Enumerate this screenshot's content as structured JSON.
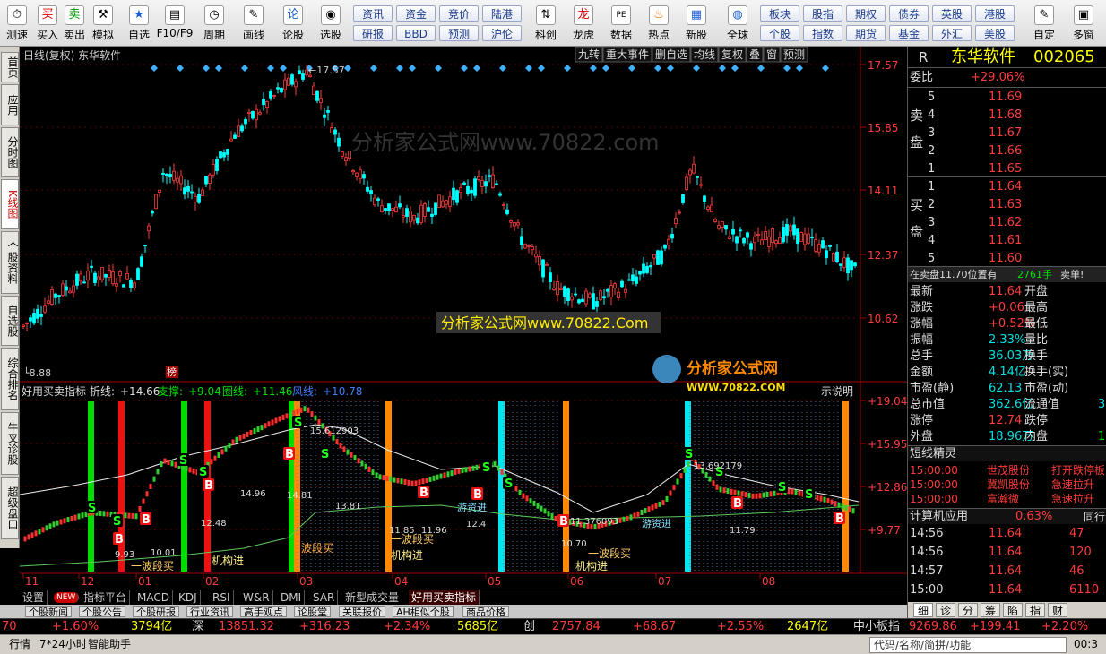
{
  "toolbar": {
    "buttons": [
      {
        "label": "测速",
        "icon": "clock-icon"
      },
      {
        "label": "买入",
        "icon": "buy-icon"
      },
      {
        "label": "卖出",
        "icon": "sell-icon"
      },
      {
        "label": "模拟",
        "icon": "gavel-icon"
      },
      {
        "label": "自选",
        "icon": "star-icon"
      },
      {
        "label": "F10/F9",
        "icon": "f10-icon"
      },
      {
        "label": "周期",
        "icon": "period-icon"
      },
      {
        "label": "画线",
        "icon": "pen-icon"
      },
      {
        "label": "论股",
        "icon": "discuss-icon"
      },
      {
        "label": "选股",
        "icon": "screen-icon"
      },
      {
        "label": "科创",
        "icon": "star-board-icon"
      },
      {
        "label": "龙虎",
        "icon": "dragon-tiger-icon"
      },
      {
        "label": "数据",
        "icon": "pe-icon"
      },
      {
        "label": "热点",
        "icon": "hot-icon"
      },
      {
        "label": "新股",
        "icon": "ipo-icon"
      },
      {
        "label": "全球",
        "icon": "globe-icon"
      },
      {
        "label": "自定",
        "icon": "custom-icon"
      },
      {
        "label": "多窗",
        "icon": "multi-window-icon"
      }
    ],
    "grid1": [
      "资讯",
      "资金",
      "竞价",
      "陆港",
      "研报",
      "BBD",
      "预测",
      "沪伦"
    ],
    "grid2": [
      "板块",
      "股指",
      "期权",
      "债券",
      "英股",
      "港股",
      "个股",
      "指数",
      "期货",
      "基金",
      "外汇",
      "美股"
    ]
  },
  "lefttabs": [
    "首页",
    "应用",
    "分时图",
    "K线图",
    "个股资料",
    "自选股",
    "综合排名",
    "牛叉诊股",
    "超级盘口"
  ],
  "chart": {
    "header": "日线(复权) 东华软件",
    "header_buttons": [
      "九转",
      "重大事件",
      "删自选",
      "均线",
      "复权",
      "叠",
      "窗",
      "预测"
    ],
    "price_axis": [
      "17.57",
      "15.85",
      "14.11",
      "12.37",
      "10.62"
    ],
    "high_label": "17.57",
    "low_label": "8.88",
    "watermark1": "分析家公式网www.70822.com",
    "watermark2": "分析家公式网www.70822.Com",
    "logo_text": "分析家公式网",
    "logo_url": "WWW.70822.COM",
    "logo_badge": "榜",
    "indicator_header": {
      "name": "好用买卖指标",
      "zx_label": "折线:",
      "zx_value": "+14.66",
      "zc_label": "支撑:",
      "zc_value": "+9.04",
      "ql_label": "圈线:",
      "ql_value": "+11.46",
      "fx_label": "风线:",
      "fx_value": "+10.78",
      "explain": "示说明"
    },
    "indicator_axis": [
      "+19.04",
      "+15.95",
      "+12.86",
      "+9.77"
    ],
    "months": [
      "11",
      "12",
      "01",
      "02",
      "03",
      "04",
      "05",
      "06",
      "07",
      "08"
    ],
    "annotations": {
      "yiboduan": "一波段买",
      "jigou": "机构进",
      "dabo": "波段买",
      "youzi": "游资进",
      "vals": [
        "14.96",
        "14.81",
        "12.48",
        "13.81",
        "11.85",
        "11.96",
        "12.4",
        "10.70",
        "11.79",
        "9.93",
        "10.01",
        "15.612903",
        "15.612903",
        "11.376093",
        "13.692179"
      ]
    }
  },
  "bottomtabs": [
    "设置",
    "NEW",
    "指标平台",
    "MACD",
    "KDJ",
    "RSI",
    "W&R",
    "DMI",
    "SAR",
    "新型成交量",
    "好用买卖指标"
  ],
  "newsbar": [
    "个股新闻",
    "个股公告",
    "个股研报",
    "行业资讯",
    "高手观点",
    "论股堂",
    "关联报价",
    "AH相似个股",
    "商品价格"
  ],
  "rpanel": {
    "code_r": "R",
    "name": "东华软件",
    "code": "002065",
    "weibi_label": "委比",
    "weibi_value": "+29.06%",
    "sell_label": "卖盘",
    "buy_label": "买盘",
    "sell": [
      [
        "5",
        "11.69"
      ],
      [
        "4",
        "11.68"
      ],
      [
        "3",
        "11.67"
      ],
      [
        "2",
        "11.66"
      ],
      [
        "1",
        "11.65"
      ]
    ],
    "buy": [
      [
        "1",
        "11.64"
      ],
      [
        "2",
        "11.63"
      ],
      [
        "3",
        "11.62"
      ],
      [
        "4",
        "11.61"
      ],
      [
        "5",
        "11.60"
      ]
    ],
    "sell_notice_pre": "在卖盘11.70位置有",
    "sell_notice_vol": "2761手",
    "sell_notice_post": "卖单!",
    "stats": [
      [
        "最新",
        "11.64",
        "开盘",
        ""
      ],
      [
        "涨跌",
        "+0.06",
        "最高",
        ""
      ],
      [
        "涨幅",
        "+0.52%",
        "最低",
        ""
      ],
      [
        "振幅",
        "2.33%",
        "量比",
        ""
      ],
      [
        "总手",
        "36.03万",
        "换手",
        ""
      ],
      [
        "金额",
        "4.14亿",
        "换手(实)",
        ""
      ],
      [
        "市盈(静)",
        "62.13",
        "市盈(动)",
        ""
      ],
      [
        "总市值",
        "362.6亿",
        "流通值",
        "3"
      ],
      [
        "涨停",
        "12.74",
        "跌停",
        ""
      ],
      [
        "外盘",
        "18.96万",
        "内盘",
        "1"
      ]
    ],
    "jingling_title": "短线精灵",
    "jingling": [
      [
        "15:00:00",
        "世茂股份",
        "打开跌停板"
      ],
      [
        "15:00:00",
        "冀凯股份",
        "急速拉升"
      ],
      [
        "15:00:00",
        "富瀚微",
        "急速拉升"
      ]
    ],
    "sector_name": "计算机应用",
    "sector_change": "0.63%",
    "sector_more": "同行",
    "ticks": [
      [
        "14:56",
        "11.64",
        "47"
      ],
      [
        "14:56",
        "11.64",
        "120"
      ],
      [
        "14:57",
        "11.64",
        "46"
      ],
      [
        "15:00",
        "11.64",
        "6110"
      ]
    ],
    "tabs": [
      "细",
      "诊",
      "分",
      "筹",
      "陷",
      "指",
      "财"
    ]
  },
  "ticker": {
    "sh_val": "70",
    "sh_pct": "+1.60%",
    "sh_amt": "3794亿",
    "sz_label": "深",
    "sz_val": "13851.32",
    "sz_chg": "+316.23",
    "sz_pct": "+2.34%",
    "sz_amt": "5685亿",
    "cy_label": "创",
    "cy_val": "2757.84",
    "cy_chg": "+68.67",
    "cy_pct": "+2.55%",
    "cy_amt": "2647亿",
    "zx_label": "中小板指",
    "zx_val": "9269.86",
    "zx_chg": "+199.41",
    "zx_pct": "+2.20%"
  },
  "statusbar": {
    "items": [
      "行情",
      "7*24小时",
      "智能助手"
    ],
    "search": "代码/名称/简拼/功能",
    "time": "00:3"
  },
  "colors": {
    "up": "#ff3c3c",
    "down": "#00ffff",
    "green_bar": "#00dd00",
    "red_bar": "#ee1111",
    "orange_bar": "#ff8800",
    "cyan_bar": "#00e5ee"
  }
}
